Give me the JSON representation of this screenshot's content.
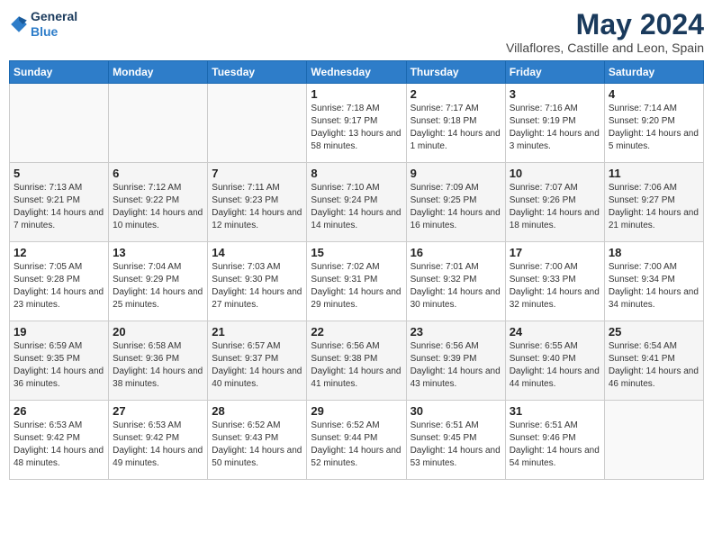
{
  "header": {
    "logo_line1": "General",
    "logo_line2": "Blue",
    "month": "May 2024",
    "location": "Villaflores, Castille and Leon, Spain"
  },
  "weekdays": [
    "Sunday",
    "Monday",
    "Tuesday",
    "Wednesday",
    "Thursday",
    "Friday",
    "Saturday"
  ],
  "weeks": [
    [
      {
        "day": "",
        "text": ""
      },
      {
        "day": "",
        "text": ""
      },
      {
        "day": "",
        "text": ""
      },
      {
        "day": "1",
        "text": "Sunrise: 7:18 AM\nSunset: 9:17 PM\nDaylight: 13 hours and 58 minutes."
      },
      {
        "day": "2",
        "text": "Sunrise: 7:17 AM\nSunset: 9:18 PM\nDaylight: 14 hours and 1 minute."
      },
      {
        "day": "3",
        "text": "Sunrise: 7:16 AM\nSunset: 9:19 PM\nDaylight: 14 hours and 3 minutes."
      },
      {
        "day": "4",
        "text": "Sunrise: 7:14 AM\nSunset: 9:20 PM\nDaylight: 14 hours and 5 minutes."
      }
    ],
    [
      {
        "day": "5",
        "text": "Sunrise: 7:13 AM\nSunset: 9:21 PM\nDaylight: 14 hours and 7 minutes."
      },
      {
        "day": "6",
        "text": "Sunrise: 7:12 AM\nSunset: 9:22 PM\nDaylight: 14 hours and 10 minutes."
      },
      {
        "day": "7",
        "text": "Sunrise: 7:11 AM\nSunset: 9:23 PM\nDaylight: 14 hours and 12 minutes."
      },
      {
        "day": "8",
        "text": "Sunrise: 7:10 AM\nSunset: 9:24 PM\nDaylight: 14 hours and 14 minutes."
      },
      {
        "day": "9",
        "text": "Sunrise: 7:09 AM\nSunset: 9:25 PM\nDaylight: 14 hours and 16 minutes."
      },
      {
        "day": "10",
        "text": "Sunrise: 7:07 AM\nSunset: 9:26 PM\nDaylight: 14 hours and 18 minutes."
      },
      {
        "day": "11",
        "text": "Sunrise: 7:06 AM\nSunset: 9:27 PM\nDaylight: 14 hours and 21 minutes."
      }
    ],
    [
      {
        "day": "12",
        "text": "Sunrise: 7:05 AM\nSunset: 9:28 PM\nDaylight: 14 hours and 23 minutes."
      },
      {
        "day": "13",
        "text": "Sunrise: 7:04 AM\nSunset: 9:29 PM\nDaylight: 14 hours and 25 minutes."
      },
      {
        "day": "14",
        "text": "Sunrise: 7:03 AM\nSunset: 9:30 PM\nDaylight: 14 hours and 27 minutes."
      },
      {
        "day": "15",
        "text": "Sunrise: 7:02 AM\nSunset: 9:31 PM\nDaylight: 14 hours and 29 minutes."
      },
      {
        "day": "16",
        "text": "Sunrise: 7:01 AM\nSunset: 9:32 PM\nDaylight: 14 hours and 30 minutes."
      },
      {
        "day": "17",
        "text": "Sunrise: 7:00 AM\nSunset: 9:33 PM\nDaylight: 14 hours and 32 minutes."
      },
      {
        "day": "18",
        "text": "Sunrise: 7:00 AM\nSunset: 9:34 PM\nDaylight: 14 hours and 34 minutes."
      }
    ],
    [
      {
        "day": "19",
        "text": "Sunrise: 6:59 AM\nSunset: 9:35 PM\nDaylight: 14 hours and 36 minutes."
      },
      {
        "day": "20",
        "text": "Sunrise: 6:58 AM\nSunset: 9:36 PM\nDaylight: 14 hours and 38 minutes."
      },
      {
        "day": "21",
        "text": "Sunrise: 6:57 AM\nSunset: 9:37 PM\nDaylight: 14 hours and 40 minutes."
      },
      {
        "day": "22",
        "text": "Sunrise: 6:56 AM\nSunset: 9:38 PM\nDaylight: 14 hours and 41 minutes."
      },
      {
        "day": "23",
        "text": "Sunrise: 6:56 AM\nSunset: 9:39 PM\nDaylight: 14 hours and 43 minutes."
      },
      {
        "day": "24",
        "text": "Sunrise: 6:55 AM\nSunset: 9:40 PM\nDaylight: 14 hours and 44 minutes."
      },
      {
        "day": "25",
        "text": "Sunrise: 6:54 AM\nSunset: 9:41 PM\nDaylight: 14 hours and 46 minutes."
      }
    ],
    [
      {
        "day": "26",
        "text": "Sunrise: 6:53 AM\nSunset: 9:42 PM\nDaylight: 14 hours and 48 minutes."
      },
      {
        "day": "27",
        "text": "Sunrise: 6:53 AM\nSunset: 9:42 PM\nDaylight: 14 hours and 49 minutes."
      },
      {
        "day": "28",
        "text": "Sunrise: 6:52 AM\nSunset: 9:43 PM\nDaylight: 14 hours and 50 minutes."
      },
      {
        "day": "29",
        "text": "Sunrise: 6:52 AM\nSunset: 9:44 PM\nDaylight: 14 hours and 52 minutes."
      },
      {
        "day": "30",
        "text": "Sunrise: 6:51 AM\nSunset: 9:45 PM\nDaylight: 14 hours and 53 minutes."
      },
      {
        "day": "31",
        "text": "Sunrise: 6:51 AM\nSunset: 9:46 PM\nDaylight: 14 hours and 54 minutes."
      },
      {
        "day": "",
        "text": ""
      }
    ]
  ]
}
